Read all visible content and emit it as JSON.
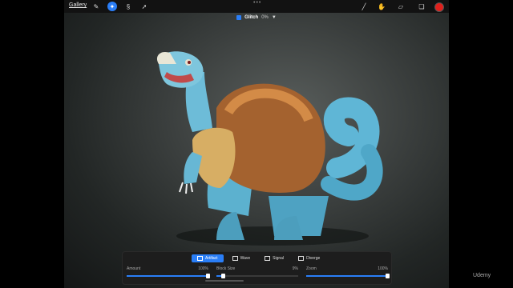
{
  "app": {
    "gallery_label": "Gallery"
  },
  "toolbar": {
    "left_tools": [
      "wrench-icon",
      "magic-wand-icon",
      "selection-s-icon",
      "transform-arrow-icon"
    ],
    "right_tools": [
      "brush-icon",
      "smudge-icon",
      "eraser-icon",
      "layers-icon"
    ],
    "color": "#e0201c"
  },
  "status": {
    "label": "Glitch",
    "value": "0%"
  },
  "glitch_panel": {
    "tabs": [
      {
        "label": "Artifact",
        "active": true
      },
      {
        "label": "Wave",
        "active": false
      },
      {
        "label": "Signal",
        "active": false
      },
      {
        "label": "Diverge",
        "active": false
      }
    ],
    "sliders": [
      {
        "label": "Amount",
        "value": "100%",
        "level": 1.0
      },
      {
        "label": "Block Size",
        "value": "9%",
        "level": 0.09
      },
      {
        "label": "Zoom",
        "value": "100%",
        "level": 1.0
      }
    ]
  },
  "watermark": "Udemy",
  "accent": "#2a7ef7"
}
